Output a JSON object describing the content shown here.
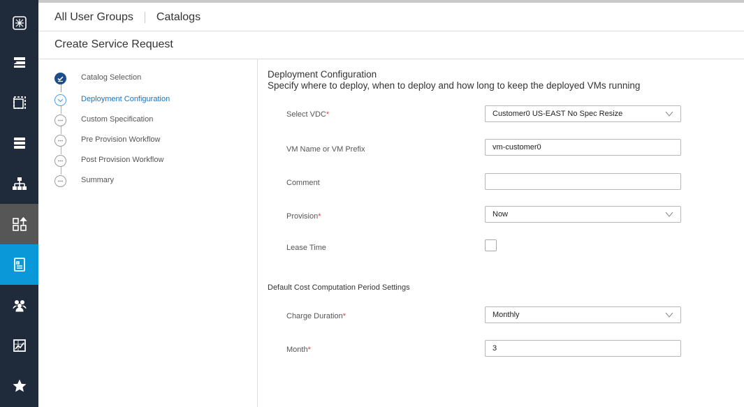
{
  "breadcrumb": {
    "root": "All User Groups",
    "current": "Catalogs"
  },
  "page": {
    "title": "Create Service Request"
  },
  "steps": [
    {
      "label": "Catalog Selection",
      "state": "done"
    },
    {
      "label": "Deployment Configuration",
      "state": "current"
    },
    {
      "label": "Custom Specification",
      "state": "pending"
    },
    {
      "label": "Pre Provision Workflow",
      "state": "pending"
    },
    {
      "label": "Post Provision Workflow",
      "state": "pending"
    },
    {
      "label": "Summary",
      "state": "pending"
    }
  ],
  "form": {
    "title": "Deployment Configuration",
    "subtitle": "Specify where to deploy, when to deploy and how long to keep the deployed VMs running",
    "vdc": {
      "label": "Select VDC",
      "value": "Customer0 US-EAST No Spec Resize"
    },
    "vm_name": {
      "label": "VM Name or VM Prefix",
      "value": "vm-customer0"
    },
    "comment": {
      "label": "Comment",
      "value": ""
    },
    "provision": {
      "label": "Provision",
      "value": "Now"
    },
    "lease_time": {
      "label": "Lease Time",
      "checked": false
    },
    "cost_section": "Default Cost Computation Period Settings",
    "charge_duration": {
      "label": "Charge Duration",
      "value": "Monthly"
    },
    "month": {
      "label": "Month",
      "value": "3"
    },
    "required_mark": "*"
  },
  "sidebar_icons": [
    "logo-icon",
    "cloud-services-icon",
    "virtual-icon",
    "physical-icon",
    "network-icon",
    "orchestration-icon",
    "catalog-icon",
    "groups-icon",
    "dashboard-icon",
    "favorites-icon"
  ],
  "colors": {
    "rail": "#1f2a3a",
    "active": "#0a99d8",
    "link": "#1a73c2",
    "required": "#e13d3d"
  }
}
